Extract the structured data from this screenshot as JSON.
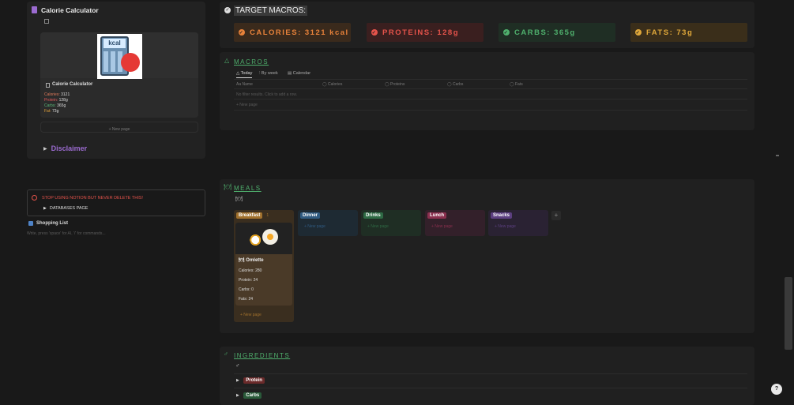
{
  "left": {
    "title": "Calorie Calculator",
    "card": {
      "image_text": "kcal",
      "title": "Calorie Calculator",
      "lines": [
        {
          "label": "Calories:",
          "value": "3121",
          "color": "#e07a5a"
        },
        {
          "label": "Protein:",
          "value": "128g",
          "color": "#e05a5a"
        },
        {
          "label": "Carbs:",
          "value": "365g",
          "color": "#5ab878"
        },
        {
          "label": "Fat:",
          "value": "73g",
          "color": "#e0a03a"
        }
      ]
    },
    "new_page": "+ New page",
    "disclaimer": "Disclaimer",
    "warning": "STOP USING NOTION BUT NEVER DELETE THIS!",
    "databases": "DATABASES PAGE",
    "shopping": "Shopping List",
    "write_hint": "Write, press 'space' for AI, '/' for commands..."
  },
  "target": {
    "title": "TARGET MACROS:",
    "boxes": [
      {
        "label": "CALORIES: 3121 kcal",
        "color": "#e8823a",
        "bg": "#3a2a1c"
      },
      {
        "label": "PROTEINS: 128g",
        "color": "#e5534b",
        "bg": "#3a1f1f"
      },
      {
        "label": "CARBS: 365g",
        "color": "#4fb06d",
        "bg": "#1f2e24"
      },
      {
        "label": "FATS: 73g",
        "color": "#e0a83a",
        "bg": "#3a2e1a"
      }
    ]
  },
  "macros": {
    "title": "MACROS",
    "tabs": [
      "Today",
      "By week",
      "Calendar"
    ],
    "columns": [
      "Name",
      "Calories",
      "Proteins",
      "Carbs",
      "Fats"
    ],
    "empty": "No filter results. Click to add a row.",
    "new_page": "+ New page"
  },
  "meals": {
    "title": "MEALS",
    "icon_text": "🍽",
    "groups": [
      {
        "name": "Breakfast",
        "count": "1",
        "color": "#a0702c",
        "bg": "#3a2e1f"
      },
      {
        "name": "Dinner",
        "count": "",
        "color": "#2f5a80",
        "bg": "#1e2a33"
      },
      {
        "name": "Drinks",
        "count": "",
        "color": "#2e6a44",
        "bg": "#1f2e24"
      },
      {
        "name": "Lunch",
        "count": "",
        "color": "#8a2f4e",
        "bg": "#33202a"
      },
      {
        "name": "Snacks",
        "count": "",
        "color": "#5c3f80",
        "bg": "#2a2233"
      }
    ],
    "card": {
      "title": "Omlette",
      "lines": [
        "Calories: 280",
        "Protein: 24",
        "Carbs: 0",
        "Fats: 24"
      ]
    },
    "new_page": "+ New page"
  },
  "ingredients": {
    "title": "INGREDIENTS",
    "items": [
      {
        "name": "Protein",
        "bg": "#6a2a2a"
      },
      {
        "name": "Carbs",
        "bg": "#2a5a3a"
      }
    ]
  }
}
